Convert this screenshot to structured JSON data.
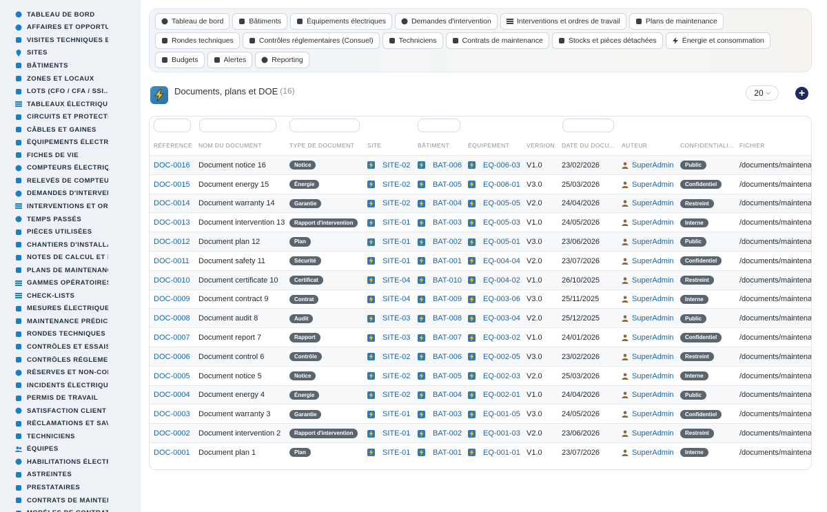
{
  "sidebar": {
    "items": [
      {
        "label": "TABLEAU DE BORD",
        "icon": "dashboard-icon"
      },
      {
        "label": "AFFAIRES ET OPPORTUN",
        "icon": "target-icon"
      },
      {
        "label": "VISITES TECHNIQUES ET",
        "icon": "path-icon"
      },
      {
        "label": "SITES",
        "icon": "location-pin-icon"
      },
      {
        "label": "BÂTIMENTS",
        "icon": "building-icon"
      },
      {
        "label": "ZONES ET LOCAUX",
        "icon": "grid-icon"
      },
      {
        "label": "LOTS (CFO / CFA / SSI...)",
        "icon": "sitemap-icon"
      },
      {
        "label": "TABLEAUX ÉLECTRIQUES",
        "icon": "table-icon"
      },
      {
        "label": "CIRCUITS ET PROTECTIO",
        "icon": "circuit-icon"
      },
      {
        "label": "CÂBLES ET GAINES",
        "icon": "cable-icon"
      },
      {
        "label": "ÉQUIPEMENTS ÉLECTRIQ",
        "icon": "cogs-icon"
      },
      {
        "label": "FICHES DE VIE",
        "icon": "history-icon"
      },
      {
        "label": "COMPTEURS ÉLECTRIQU",
        "icon": "gauge-icon"
      },
      {
        "label": "RELEVÉS DE COMPTEURS",
        "icon": "clipboard-icon"
      },
      {
        "label": "DEMANDES D'INTERVENT",
        "icon": "question-circle-icon"
      },
      {
        "label": "INTERVENTIONS ET ORDI",
        "icon": "clipboard-list-icon"
      },
      {
        "label": "TEMPS PASSÉS",
        "icon": "clock-icon"
      },
      {
        "label": "PIÈCES UTILISÉES",
        "icon": "boxes-icon"
      },
      {
        "label": "CHANTIERS D'INSTALLAT",
        "icon": "hammer-icon"
      },
      {
        "label": "NOTES DE CALCUL ET ÉT",
        "icon": "calculator-icon"
      },
      {
        "label": "PLANS DE MAINTENANCE",
        "icon": "calendar-icon"
      },
      {
        "label": "GAMMES OPÉRATOIRES",
        "icon": "layers-icon"
      },
      {
        "label": "CHECK-LISTS",
        "icon": "list-check-icon"
      },
      {
        "label": "MESURES ÉLECTRIQUES",
        "icon": "thermometer-icon"
      },
      {
        "label": "MAINTENANCE PRÉDICTI",
        "icon": "chart-line-icon"
      },
      {
        "label": "RONDES TECHNIQUES",
        "icon": "route-icon"
      },
      {
        "label": "CONTRÔLES ET ESSAIS",
        "icon": "search-icon"
      },
      {
        "label": "CONTRÔLES RÉGLEMENT",
        "icon": "file-check-icon"
      },
      {
        "label": "RÉSERVES ET NON-CONF",
        "icon": "alert-circle-icon"
      },
      {
        "label": "INCIDENTS ÉLECTRIQUES",
        "icon": "warning-icon"
      },
      {
        "label": "PERMIS DE TRAVAIL",
        "icon": "file-signature-icon"
      },
      {
        "label": "SATISFACTION CLIENT",
        "icon": "smile-icon"
      },
      {
        "label": "RÉCLAMATIONS ET SAV",
        "icon": "comment-icon"
      },
      {
        "label": "TECHNICIENS",
        "icon": "hard-hat-icon"
      },
      {
        "label": "ÉQUIPES",
        "icon": "users-icon"
      },
      {
        "label": "HABILITATIONS ÉLECTRI",
        "icon": "certificate-icon"
      },
      {
        "label": "ASTREINTES",
        "icon": "phone-icon"
      },
      {
        "label": "PRESTATAIRES",
        "icon": "handshake-icon"
      },
      {
        "label": "CONTRATS DE MAINTENA",
        "icon": "file-contract-icon"
      },
      {
        "label": "MODÈLES DE CONTRATS",
        "icon": "file-alt-icon"
      }
    ]
  },
  "topnav": {
    "chips": [
      {
        "label": "Tableau de bord",
        "icon": "dashboard-icon"
      },
      {
        "label": "Bâtiments",
        "icon": "building-icon"
      },
      {
        "label": "Équipements électriques",
        "icon": "cogs-icon"
      },
      {
        "label": "Demandes d'intervention",
        "icon": "question-circle-icon"
      },
      {
        "label": "Interventions et ordres de travail",
        "icon": "clipboard-list-icon"
      },
      {
        "label": "Plans de maintenance",
        "icon": "calendar-icon"
      },
      {
        "label": "Rondes techniques",
        "icon": "route-icon"
      },
      {
        "label": "Contrôles réglementaires (Consuel)",
        "icon": "file-check-icon"
      },
      {
        "label": "Techniciens",
        "icon": "hard-hat-icon"
      },
      {
        "label": "Contrats de maintenance",
        "icon": "file-contract-icon"
      },
      {
        "label": "Stocks et pièces détachées",
        "icon": "boxes-icon"
      },
      {
        "label": "Énergie et consommation",
        "icon": "bolt-icon"
      },
      {
        "label": "Budgets",
        "icon": "money-icon"
      },
      {
        "label": "Alertes",
        "icon": "bell-icon"
      },
      {
        "label": "Reporting",
        "icon": "chart-pie-icon"
      }
    ]
  },
  "page": {
    "title": "Documents, plans et DOE",
    "count": "(16)",
    "per_page": "20",
    "add_label": "+"
  },
  "colors": {
    "accent": "#1766a8",
    "badge_gray": "#5b6570",
    "add_button": "#1d2a5c"
  },
  "table": {
    "columns": [
      "RÉFÉRENCE",
      "NOM DU DOCUMENT",
      "TYPE DE DOCUMENT",
      "SITE",
      "BÂTIMENT",
      "ÉQUIPEMENT",
      "VERSION",
      "DATE DU DOCU...",
      "AUTEUR",
      "CONFIDENTIALI...",
      "FICHIER"
    ],
    "rows": [
      {
        "ref": "DOC-0016",
        "name": "Document notice 16",
        "type": "Notice",
        "site": "SITE-02",
        "bat": "BAT-006",
        "eq": "EQ-006-03",
        "version": "V1.0",
        "date": "23/02/2026",
        "author": "SuperAdmin",
        "conf": "Public",
        "file": "/documents/maintenar"
      },
      {
        "ref": "DOC-0015",
        "name": "Document energy 15",
        "type": "Énergie",
        "site": "SITE-02",
        "bat": "BAT-005",
        "eq": "EQ-006-01",
        "version": "V3.0",
        "date": "25/03/2026",
        "author": "SuperAdmin",
        "conf": "Confidentiel",
        "file": "/documents/maintenar"
      },
      {
        "ref": "DOC-0014",
        "name": "Document warranty 14",
        "type": "Garantie",
        "site": "SITE-02",
        "bat": "BAT-004",
        "eq": "EQ-005-05",
        "version": "V2.0",
        "date": "24/04/2026",
        "author": "SuperAdmin",
        "conf": "Restreint",
        "file": "/documents/maintenar"
      },
      {
        "ref": "DOC-0013",
        "name": "Document intervention 13",
        "type": "Rapport d'intervention",
        "site": "SITE-01",
        "bat": "BAT-003",
        "eq": "EQ-005-03",
        "version": "V1.0",
        "date": "24/05/2026",
        "author": "SuperAdmin",
        "conf": "Interne",
        "file": "/documents/maintenar"
      },
      {
        "ref": "DOC-0012",
        "name": "Document plan 12",
        "type": "Plan",
        "site": "SITE-01",
        "bat": "BAT-002",
        "eq": "EQ-005-01",
        "version": "V3.0",
        "date": "23/06/2026",
        "author": "SuperAdmin",
        "conf": "Public",
        "file": "/documents/maintenar"
      },
      {
        "ref": "DOC-0011",
        "name": "Document safety 11",
        "type": "Sécurité",
        "site": "SITE-01",
        "bat": "BAT-001",
        "eq": "EQ-004-04",
        "version": "V2.0",
        "date": "23/07/2026",
        "author": "SuperAdmin",
        "conf": "Confidentiel",
        "file": "/documents/maintenar"
      },
      {
        "ref": "DOC-0010",
        "name": "Document certificate 10",
        "type": "Certificat",
        "site": "SITE-04",
        "bat": "BAT-010",
        "eq": "EQ-004-02",
        "version": "V1.0",
        "date": "26/10/2025",
        "author": "SuperAdmin",
        "conf": "Restreint",
        "file": "/documents/maintenar"
      },
      {
        "ref": "DOC-0009",
        "name": "Document contract 9",
        "type": "Contrat",
        "site": "SITE-04",
        "bat": "BAT-009",
        "eq": "EQ-003-06",
        "version": "V3.0",
        "date": "25/11/2025",
        "author": "SuperAdmin",
        "conf": "Interne",
        "file": "/documents/maintenar"
      },
      {
        "ref": "DOC-0008",
        "name": "Document audit 8",
        "type": "Audit",
        "site": "SITE-03",
        "bat": "BAT-008",
        "eq": "EQ-003-04",
        "version": "V2.0",
        "date": "25/12/2025",
        "author": "SuperAdmin",
        "conf": "Public",
        "file": "/documents/maintenar"
      },
      {
        "ref": "DOC-0007",
        "name": "Document report 7",
        "type": "Rapport",
        "site": "SITE-03",
        "bat": "BAT-007",
        "eq": "EQ-003-02",
        "version": "V1.0",
        "date": "24/01/2026",
        "author": "SuperAdmin",
        "conf": "Confidentiel",
        "file": "/documents/maintenar"
      },
      {
        "ref": "DOC-0006",
        "name": "Document control 6",
        "type": "Contrôle",
        "site": "SITE-02",
        "bat": "BAT-006",
        "eq": "EQ-002-05",
        "version": "V3.0",
        "date": "23/02/2026",
        "author": "SuperAdmin",
        "conf": "Restreint",
        "file": "/documents/maintenar"
      },
      {
        "ref": "DOC-0005",
        "name": "Document notice 5",
        "type": "Notice",
        "site": "SITE-02",
        "bat": "BAT-005",
        "eq": "EQ-002-03",
        "version": "V2.0",
        "date": "25/03/2026",
        "author": "SuperAdmin",
        "conf": "Interne",
        "file": "/documents/maintenar"
      },
      {
        "ref": "DOC-0004",
        "name": "Document energy 4",
        "type": "Énergie",
        "site": "SITE-02",
        "bat": "BAT-004",
        "eq": "EQ-002-01",
        "version": "V1.0",
        "date": "24/04/2026",
        "author": "SuperAdmin",
        "conf": "Public",
        "file": "/documents/maintenar"
      },
      {
        "ref": "DOC-0003",
        "name": "Document warranty 3",
        "type": "Garantie",
        "site": "SITE-01",
        "bat": "BAT-003",
        "eq": "EQ-001-05",
        "version": "V3.0",
        "date": "24/05/2026",
        "author": "SuperAdmin",
        "conf": "Confidentiel",
        "file": "/documents/maintenar"
      },
      {
        "ref": "DOC-0002",
        "name": "Document intervention 2",
        "type": "Rapport d'intervention",
        "site": "SITE-01",
        "bat": "BAT-002",
        "eq": "EQ-001-03",
        "version": "V2.0",
        "date": "23/06/2026",
        "author": "SuperAdmin",
        "conf": "Restreint",
        "file": "/documents/maintenar"
      },
      {
        "ref": "DOC-0001",
        "name": "Document plan 1",
        "type": "Plan",
        "site": "SITE-01",
        "bat": "BAT-001",
        "eq": "EQ-001-01",
        "version": "V1.0",
        "date": "23/07/2026",
        "author": "SuperAdmin",
        "conf": "Interne",
        "file": "/documents/maintenar"
      }
    ]
  }
}
